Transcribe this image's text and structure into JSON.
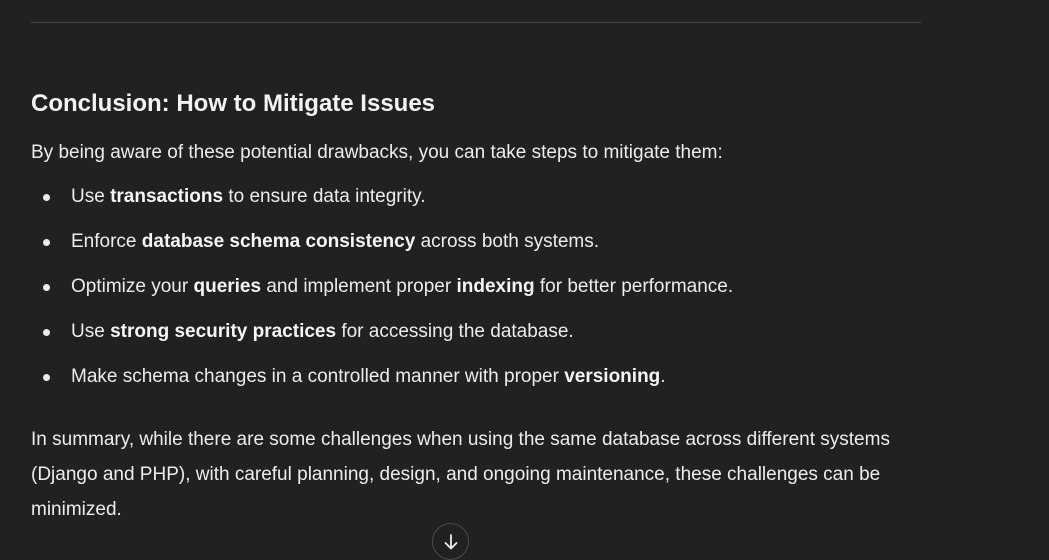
{
  "section": {
    "heading": "Conclusion: How to Mitigate Issues",
    "intro": "By being aware of these potential drawbacks, you can take steps to mitigate them:",
    "items": [
      {
        "pre": "Use ",
        "bold1": "transactions",
        "mid": " to ensure data integrity.",
        "bold2": "",
        "post": ""
      },
      {
        "pre": "Enforce ",
        "bold1": "database schema consistency",
        "mid": " across both systems.",
        "bold2": "",
        "post": ""
      },
      {
        "pre": "Optimize your ",
        "bold1": "queries",
        "mid": " and implement proper ",
        "bold2": "indexing",
        "post": " for better performance."
      },
      {
        "pre": "Use ",
        "bold1": "strong security practices",
        "mid": " for accessing the database.",
        "bold2": "",
        "post": ""
      },
      {
        "pre": "Make schema changes in a controlled manner with proper ",
        "bold1": "versioning",
        "mid": ".",
        "bold2": "",
        "post": ""
      }
    ],
    "summary": "In summary, while there are some challenges when using the same database across different systems (Django and PHP), with careful planning, design, and ongoing maintenance, these challenges can be minimized."
  },
  "scroll_button": {
    "icon": "arrow-down-icon"
  }
}
